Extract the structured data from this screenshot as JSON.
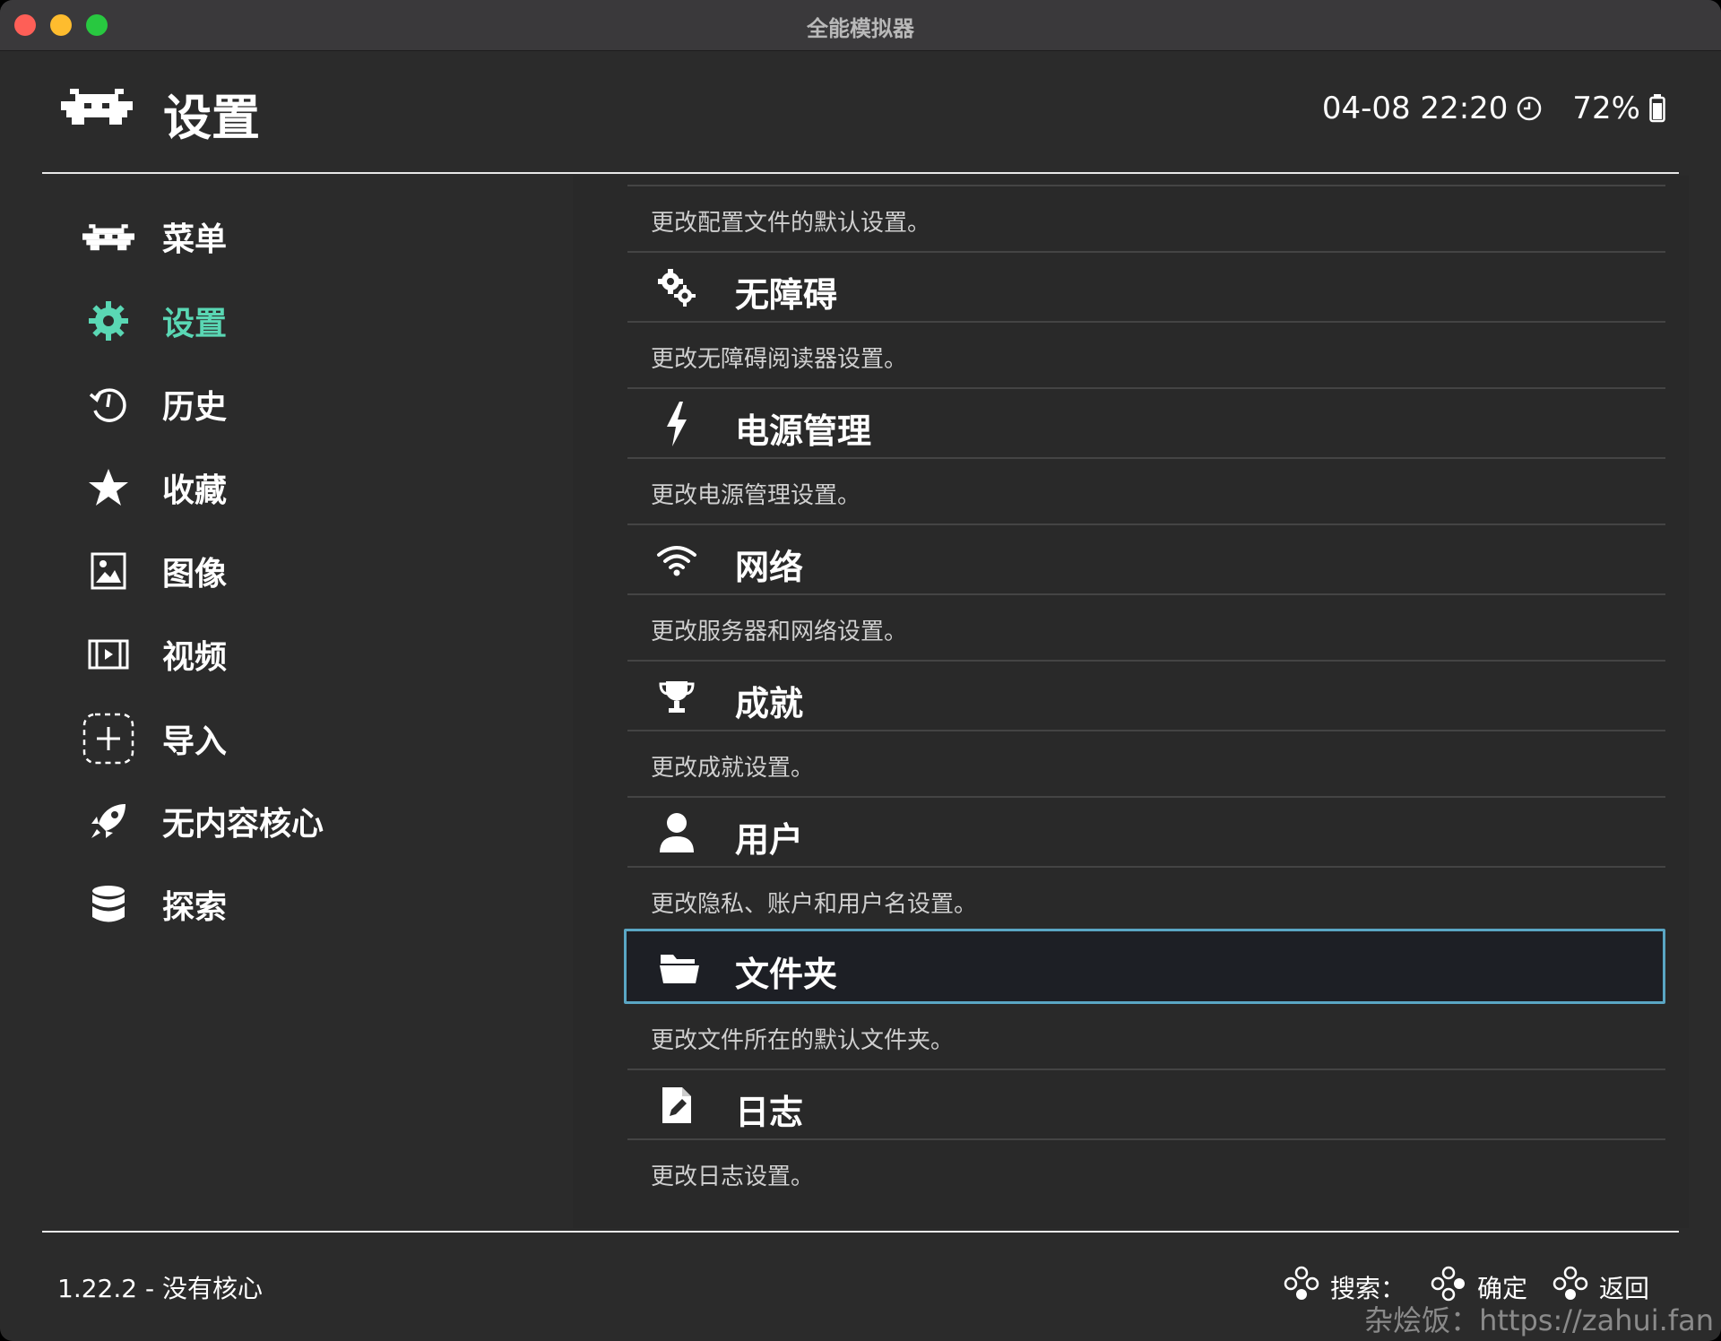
{
  "window": {
    "title": "全能模拟器"
  },
  "header": {
    "title": "设置",
    "datetime": "04-08 22:20",
    "battery": "72%"
  },
  "sidebar": {
    "items": [
      {
        "label": "菜单",
        "icon": "retroarch-invader-icon",
        "active": false
      },
      {
        "label": "设置",
        "icon": "gear-icon",
        "active": true
      },
      {
        "label": "历史",
        "icon": "history-icon",
        "active": false
      },
      {
        "label": "收藏",
        "icon": "star-icon",
        "active": false
      },
      {
        "label": "图像",
        "icon": "image-icon",
        "active": false
      },
      {
        "label": "视频",
        "icon": "video-icon",
        "active": false
      },
      {
        "label": "导入",
        "icon": "add-icon",
        "active": false
      },
      {
        "label": "无内容核心",
        "icon": "rocket-icon",
        "active": false
      },
      {
        "label": "探索",
        "icon": "database-icon",
        "active": false
      }
    ]
  },
  "settings": {
    "top_desc": "更改配置文件的默认设置。",
    "items": [
      {
        "title": "无障碍",
        "desc": "更改无障碍阅读器设置。",
        "icon": "accessibility-gears-icon"
      },
      {
        "title": "电源管理",
        "desc": "更改电源管理设置。",
        "icon": "lightning-icon"
      },
      {
        "title": "网络",
        "desc": "更改服务器和网络设置。",
        "icon": "wifi-icon"
      },
      {
        "title": "成就",
        "desc": "更改成就设置。",
        "icon": "trophy-icon"
      },
      {
        "title": "用户",
        "desc": "更改隐私、账户和用户名设置。",
        "icon": "user-icon"
      },
      {
        "title": "文件夹",
        "desc": "更改文件所在的默认文件夹。",
        "icon": "folder-icon",
        "selected": true
      },
      {
        "title": "日志",
        "desc": "更改日志设置。",
        "icon": "log-file-icon"
      }
    ]
  },
  "footer": {
    "version": "1.22.2 - 没有核心",
    "hints": {
      "search": "搜索：",
      "confirm": "确定",
      "back": "返回"
    },
    "watermark": "杂烩饭：https://zahui.fan"
  },
  "colors": {
    "accent": "#5ad7b4",
    "selection_border": "#5aa6c4",
    "background": "#2b2b2b"
  }
}
